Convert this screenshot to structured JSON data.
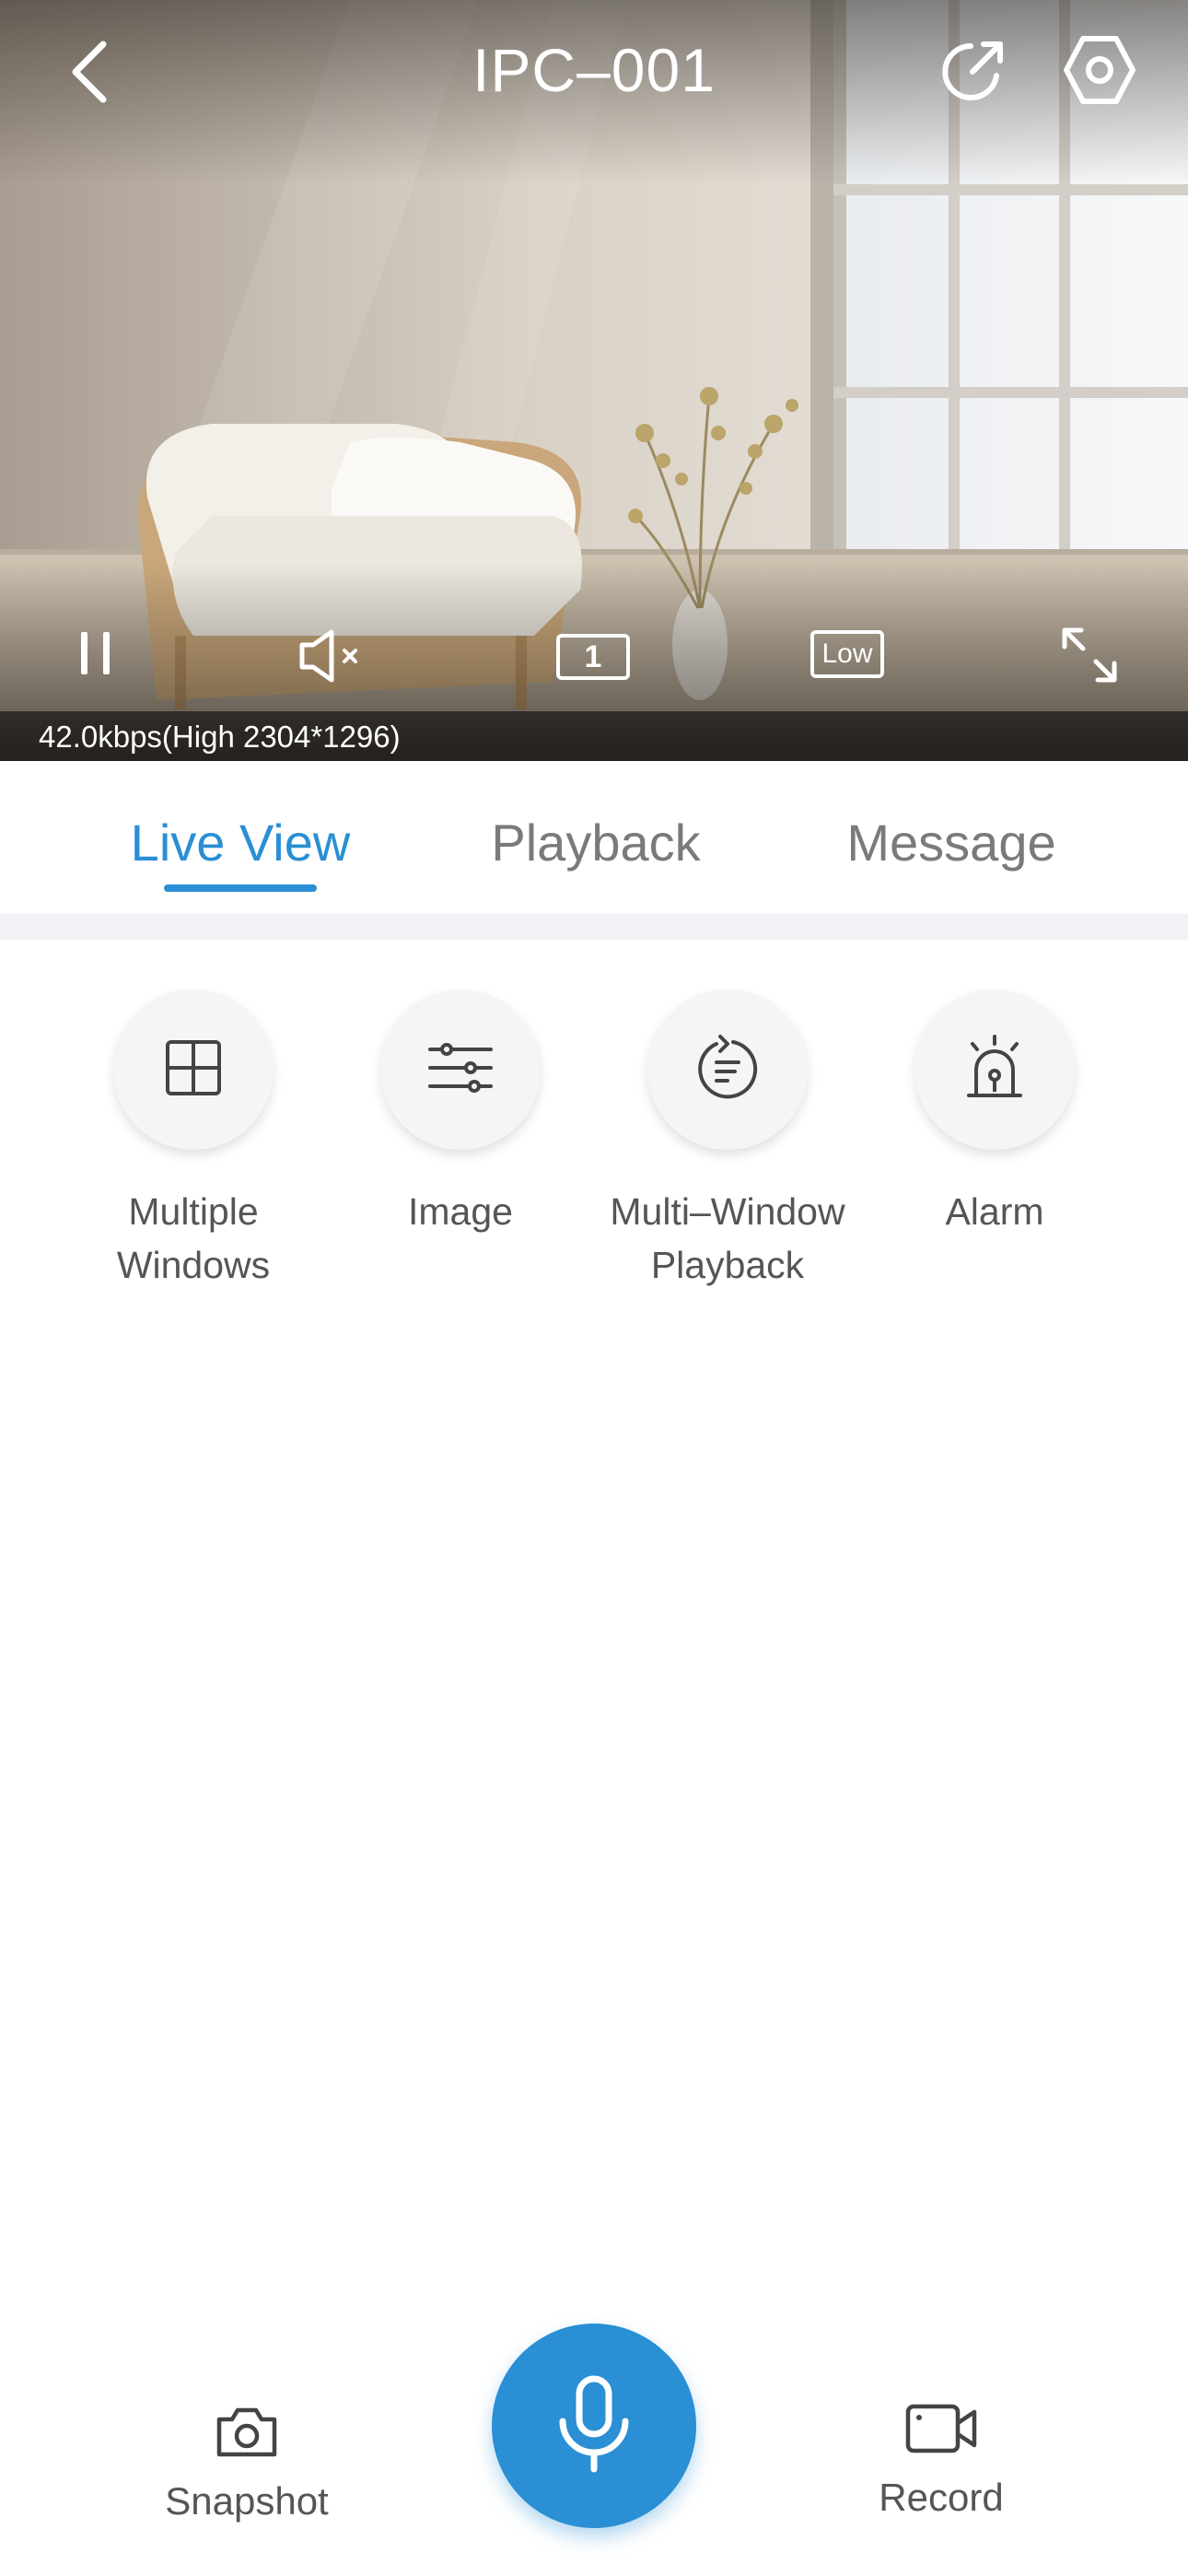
{
  "header": {
    "title": "IPC–001"
  },
  "video": {
    "stream_info": "42.0kbps(High 2304*1296)",
    "channel_badge": "1",
    "quality_badge": "Low"
  },
  "tabs": [
    {
      "label": "Live View",
      "active": true
    },
    {
      "label": "Playback",
      "active": false
    },
    {
      "label": "Message",
      "active": false
    }
  ],
  "functions": [
    {
      "label": "Multiple\nWindows",
      "icon": "grid-icon"
    },
    {
      "label": "Image",
      "icon": "sliders-icon"
    },
    {
      "label": "Multi–Window\nPlayback",
      "icon": "playback-icon"
    },
    {
      "label": "Alarm",
      "icon": "alarm-icon"
    }
  ],
  "bottom_bar": {
    "snapshot_label": "Snapshot",
    "record_label": "Record",
    "talk_icon": "microphone-icon"
  },
  "colors": {
    "accent": "#2a8fd4",
    "text_gray": "#555555",
    "tab_inactive": "#7a7a7a"
  }
}
